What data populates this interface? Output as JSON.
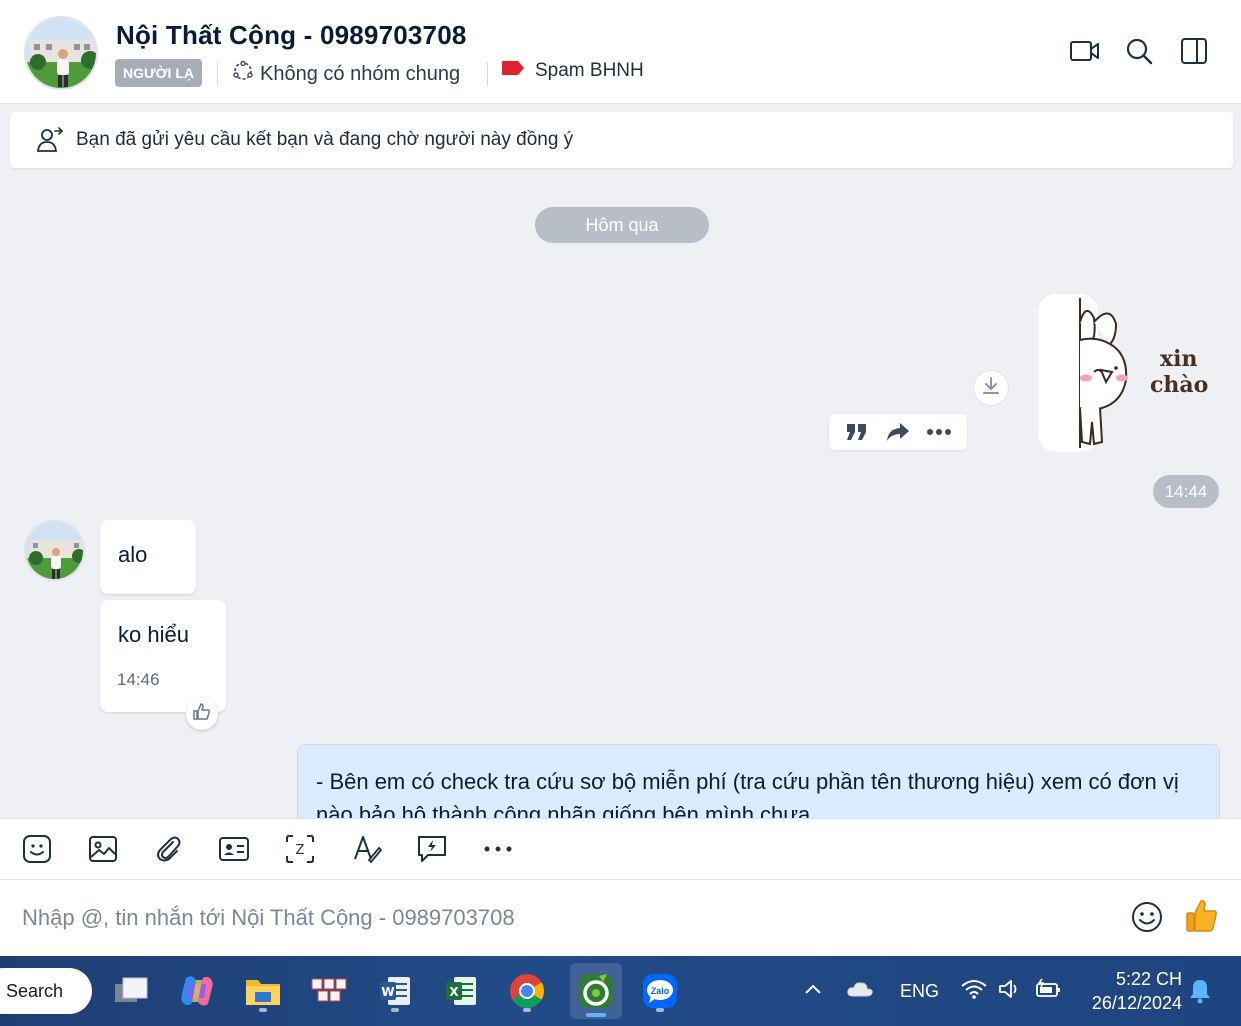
{
  "header": {
    "contact_name": "Nội Thất Cộng - 0989703708",
    "stranger_tag": "NGƯỜI LẠ",
    "common_groups": "Không có nhóm chung",
    "label": "Spam BHNH",
    "label_color": "#e0212f"
  },
  "banner": {
    "text": "Bạn đã gửi yêu cầu kết bạn và đang chờ người này đồng ý"
  },
  "chat": {
    "date_divider": "Hôm qua",
    "sticker_text_line1": "xin",
    "sticker_text_line2": "chào",
    "sticker_time": "14:44",
    "incoming": [
      {
        "text": "alo"
      },
      {
        "text": "ko hiểu",
        "time": "14:46"
      }
    ],
    "outgoing_text": "- Bên em có check tra cứu sơ bộ miễn phí (tra cứu phần tên thương hiệu) xem có đơn vị nào bảo hộ thành công nhãn giống bên mình chưa"
  },
  "composer": {
    "placeholder": "Nhập @, tin nhắn tới Nội Thất Cộng - 0989703708"
  },
  "taskbar": {
    "search_label": "Search",
    "language": "ENG",
    "time": "5:22 CH",
    "date": "26/12/2024",
    "zalo_label": "Zalo"
  },
  "colors": {
    "accent": "#0068ff",
    "outgoing_bubble": "#dbebff",
    "chat_background": "#eef0f3",
    "taskbar": "#1f4580"
  }
}
